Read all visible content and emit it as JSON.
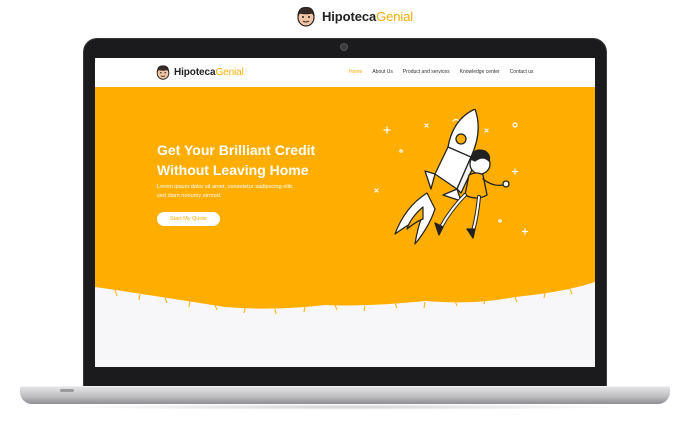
{
  "brand": {
    "name_bold": "Hipoteca",
    "name_light": "Genial"
  },
  "site": {
    "brand": {
      "name_bold": "Hipoteca",
      "name_light": "Genial"
    },
    "nav": {
      "items": [
        {
          "label": "Home",
          "active": true
        },
        {
          "label": "About Us",
          "active": false
        },
        {
          "label": "Product and services",
          "active": false
        },
        {
          "label": "Knowledge center",
          "active": false
        },
        {
          "label": "Contact us",
          "active": false
        }
      ]
    },
    "hero": {
      "title_line1": "Get Your Brilliant Credit",
      "title_line2": "Without Leaving Home",
      "text_line1": "Lorem ipsum dolor sit amet, consetetur sadipscing elitr,",
      "text_line2": "sed diam nonumy eirmod.",
      "cta_label": "Start My Quote",
      "illustration": "rocket-man-illustration"
    }
  },
  "colors": {
    "accent": "#f6ad03",
    "hero_background": "#ffae00",
    "page_background": "#f7f6f8",
    "device_frame": "#1b1b1d"
  }
}
